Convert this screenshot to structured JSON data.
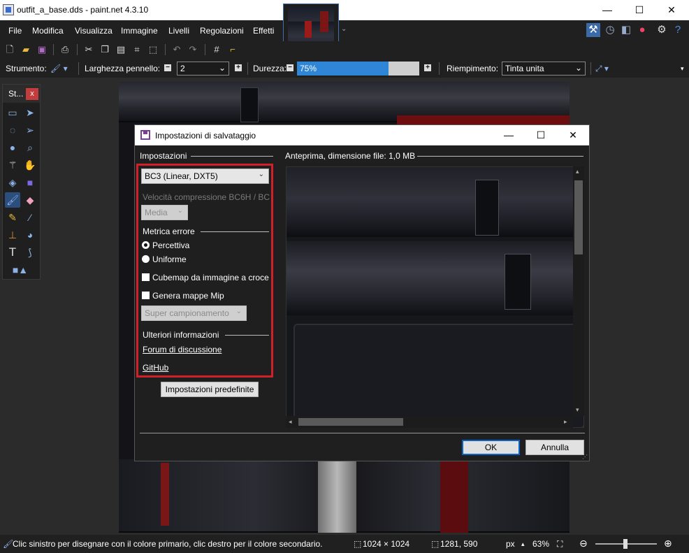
{
  "window": {
    "title": "outfit_a_base.dds - paint.net 4.3.10",
    "minimize": "—",
    "maximize": "☐",
    "close": "✕"
  },
  "menu": [
    "File",
    "Modifica",
    "Visualizza",
    "Immagine",
    "Livelli",
    "Regolazioni",
    "Effetti"
  ],
  "toolbar_right_icons": [
    "tools-icon",
    "history-icon",
    "layers-icon",
    "colors-icon",
    "settings-icon",
    "help-icon"
  ],
  "options": {
    "tool_label": "Strumento:",
    "brush_width_label": "Larghezza pennello:",
    "brush_width_value": "2",
    "hardness_label": "Durezza:",
    "hardness_value": "75%",
    "hardness_fraction": 0.75,
    "fill_label": "Riempimento:",
    "fill_value": "Tinta unita"
  },
  "tools_panel": {
    "title": "St...",
    "close": "x",
    "active_tool": "paintbrush-tool"
  },
  "dialog": {
    "title": "Impostazioni di salvataggio",
    "settings_heading": "Impostazioni",
    "preview_heading": "Anteprima, dimensione file: 1,0 MB",
    "format_value": "BC3 (Linear, DXT5)",
    "compression_speed_label": "Velocità compressione BC6H / BC7",
    "compression_speed_value": "Media",
    "error_metric_heading": "Metrica errore",
    "radio_perceptual": "Percettiva",
    "radio_uniform": "Uniforme",
    "error_metric_selected": "Percettiva",
    "cubemap_label": "Cubemap da immagine a croce",
    "cubemap_checked": false,
    "mipmaps_label": "Genera mappe Mip",
    "mipmaps_checked": false,
    "resampling_value": "Super campionamento",
    "more_info_heading": "Ulteriori informazioni",
    "forum_link": "Forum di discussione",
    "github_link": "GitHub",
    "defaults_button": "Impostazioni predefinite",
    "ok_button": "OK",
    "cancel_button": "Annulla"
  },
  "status": {
    "hint": "Clic sinistro per disegnare con il colore primario, clic destro per il colore secondario.",
    "image_size": "1024 × 1024",
    "cursor_pos": "1281, 590",
    "unit": "px",
    "zoom": "63%"
  },
  "colors": {
    "accent": "#2f86d6",
    "highlight_border": "#d0202a",
    "dialog_bg": "#1f1f1f"
  }
}
